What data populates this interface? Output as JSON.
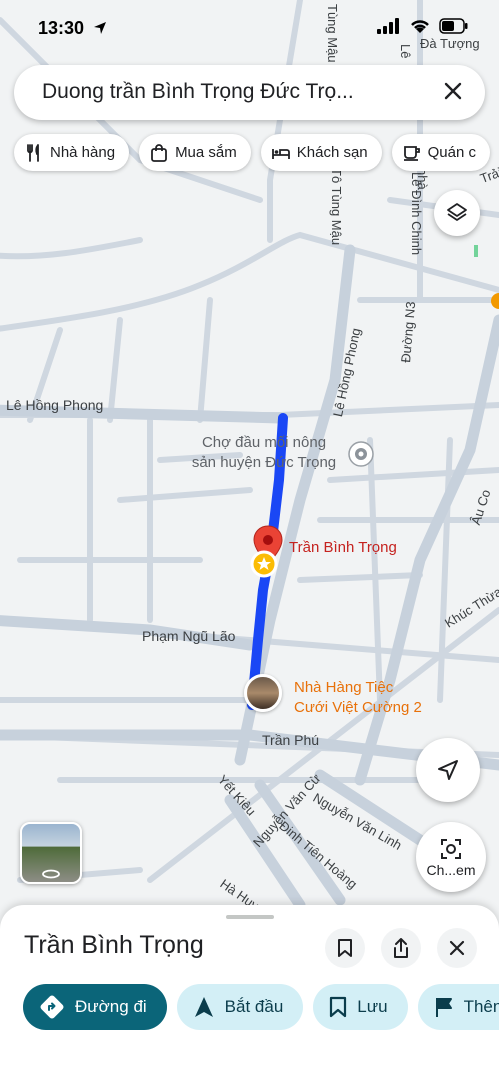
{
  "status_bar": {
    "time": "13:30"
  },
  "search": {
    "query": "Duong trần Bình Trọng Đức Trọ..."
  },
  "chips": [
    {
      "label": "Nhà hàng",
      "icon": "restaurant-icon"
    },
    {
      "label": "Mua sắm",
      "icon": "shopping-bag-icon"
    },
    {
      "label": "Khách sạn",
      "icon": "hotel-bed-icon"
    },
    {
      "label": "Quán c",
      "icon": "coffee-icon"
    }
  ],
  "map": {
    "streets": {
      "tung_mau_top": "Tùng Mậu",
      "le_label_top": "Lê",
      "da_tuong": "Đà Tượng",
      "to_tung_mau": "Tô Tùng Mậu",
      "le_dinh_chinh": "Lê Đình Chinh",
      "le_hong_phong_vert": "Lê Hồng Phong",
      "duong_n3": "Đường N3",
      "le_hong_phong": "Lê Hồng Phong",
      "au_co": "Âu Co",
      "khuc_thua": "Khúc Thừa",
      "pham_ngu_lao": "Phạm Ngũ Lão",
      "tran_phu": "Trần Phú",
      "yet_kieu": "Yết Kiêu",
      "nguyen_van_cu": "Nguyễn Văn Cừ",
      "nguyen_van_linh": "Nguyễn Văn Linh",
      "dinh_tien_hoang": "Đinh Tiên Hoàng",
      "ha_huy": "Hà Huy",
      "trai": "Trải",
      "nha_fragment": "nhà"
    },
    "poi_market": {
      "line1": "Chợ đầu mối nông",
      "line2": "sản huyện Đức Trọng"
    },
    "pin_label": "Trần Bình Trọng",
    "restaurant": {
      "line1": "Nhà Hàng Tiệc",
      "line2": "Cưới Việt Cường 2"
    },
    "route_color": "#1a47f5"
  },
  "side_buttons": {
    "chat_label": "Ch...em"
  },
  "sheet": {
    "title": "Trần Bình Trọng",
    "actions": [
      {
        "label": "Đường đi",
        "icon": "directions-icon"
      },
      {
        "label": "Bắt đầu",
        "icon": "navigation-arrow-icon"
      },
      {
        "label": "Lưu",
        "icon": "bookmark-icon"
      },
      {
        "label": "Thên",
        "icon": "flag-icon"
      }
    ]
  }
}
